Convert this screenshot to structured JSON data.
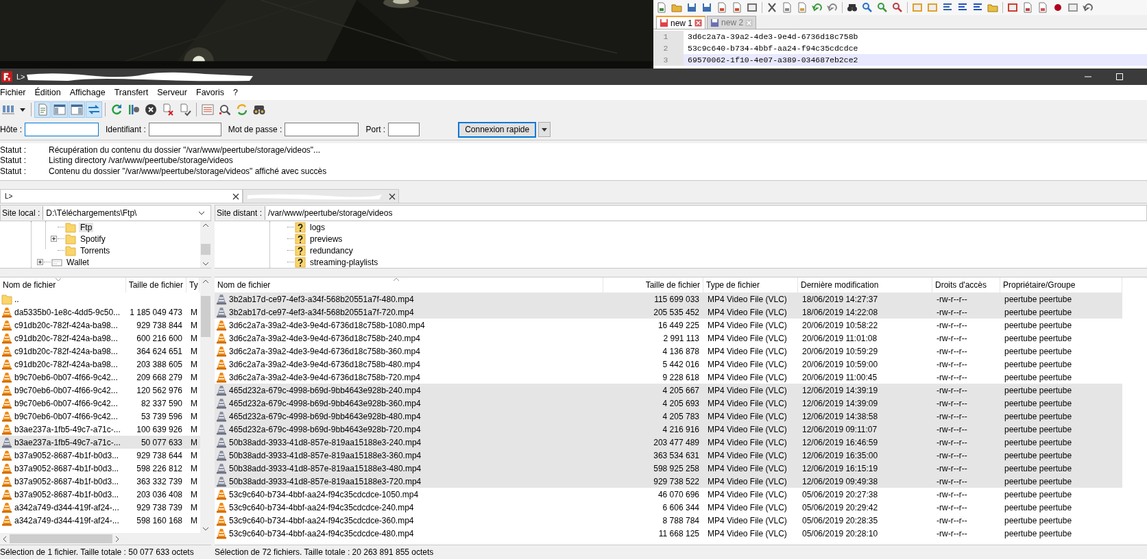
{
  "notepad": {
    "tabs": [
      {
        "label": "new 1",
        "selected": true
      },
      {
        "label": "new 2",
        "selected": false
      }
    ],
    "lines": [
      {
        "number": "1",
        "text": "3d6c2a7a-39a2-4de3-9e4d-6736d18c758b",
        "current": false
      },
      {
        "number": "2",
        "text": "53c9c640-b734-4bbf-aa24-f94c35cdcdce",
        "current": false
      },
      {
        "number": "3",
        "text": "69570062-1f10-4e07-a389-034687eb2ce2",
        "current": true
      }
    ]
  },
  "window": {
    "title": "L>"
  },
  "menu": [
    "Fichier",
    "Édition",
    "Affichage",
    "Transfert",
    "Serveur",
    "Favoris",
    "?"
  ],
  "toolbar": [
    {
      "kind": "site-manager",
      "on": false
    },
    {
      "kind": "message-log",
      "on": true
    },
    {
      "kind": "local-tree",
      "on": true
    },
    {
      "kind": "remote-tree",
      "on": true
    },
    {
      "kind": "transfer-queue",
      "on": true
    },
    {
      "kind": "refresh",
      "on": false
    },
    {
      "kind": "process-queue",
      "on": false
    },
    {
      "kind": "cancel",
      "on": false
    },
    {
      "kind": "disconnect",
      "on": false
    },
    {
      "kind": "reconnect",
      "on": false
    },
    {
      "kind": "filter",
      "on": false
    },
    {
      "kind": "compare",
      "on": false
    },
    {
      "kind": "sync",
      "on": false
    },
    {
      "kind": "find",
      "on": false
    }
  ],
  "quickconnect": {
    "fields": [
      {
        "label": "Hôte :",
        "focused": true
      },
      {
        "label": "Identifiant :",
        "focused": false
      },
      {
        "label": "Mot de passe :",
        "focused": false
      },
      {
        "label": "Port :",
        "focused": false
      }
    ],
    "button": "Connexion rapide"
  },
  "log": [
    {
      "label": "Statut :",
      "text": "Récupération du contenu du dossier \"/var/www/peertube/storage/videos\"..."
    },
    {
      "label": "Statut :",
      "text": "Listing directory /var/www/peertube/storage/videos"
    },
    {
      "label": "Statut :",
      "text": "Contenu du dossier \"/var/www/peertube/storage/videos\" affiché avec succès"
    }
  ],
  "tabs": [
    {
      "label": "L>",
      "selected": true
    },
    {
      "selected": false
    }
  ],
  "local": {
    "site_label": "Site local :",
    "path": "D:\\Téléchargements\\Ftp\\",
    "tree": [
      {
        "children": [
          {
            "label": "Ftp",
            "kind": "folder",
            "selected": true,
            "expandable": false
          },
          {
            "label": "Spotify",
            "kind": "folder",
            "selected": false,
            "expandable": true
          },
          {
            "label": "Torrents",
            "kind": "folder",
            "selected": false,
            "expandable": false
          }
        ]
      },
      {
        "label": "Wallet",
        "kind": "drive",
        "selected": false,
        "expandable": true
      }
    ],
    "columns": [
      {
        "label": "Nom de fichier"
      },
      {
        "label": "Taille de fichier"
      },
      {
        "label": "Ty"
      }
    ],
    "rows": [
      {
        "kind": "folder",
        "name": "..",
        "selected": false
      },
      {
        "kind": "video",
        "name": "da5335b0-1e8c-4dd5-9c50...",
        "size": "1 185 049 473",
        "type": "M",
        "selected": false
      },
      {
        "kind": "video",
        "name": "c91db20c-782f-424a-ba98...",
        "size": "929 738 844",
        "type": "M",
        "selected": false
      },
      {
        "kind": "video",
        "name": "c91db20c-782f-424a-ba98...",
        "size": "600 216 600",
        "type": "M",
        "selected": false
      },
      {
        "kind": "video",
        "name": "c91db20c-782f-424a-ba98...",
        "size": "364 624 651",
        "type": "M",
        "selected": false
      },
      {
        "kind": "video",
        "name": "c91db20c-782f-424a-ba98...",
        "size": "203 388 605",
        "type": "M",
        "selected": false
      },
      {
        "kind": "video",
        "name": "b9c70eb6-0b07-4f66-9c42...",
        "size": "209 668 279",
        "type": "M",
        "selected": false
      },
      {
        "kind": "video",
        "name": "b9c70eb6-0b07-4f66-9c42...",
        "size": "120 562 976",
        "type": "M",
        "selected": false
      },
      {
        "kind": "video",
        "name": "b9c70eb6-0b07-4f66-9c42...",
        "size": "82 337 590",
        "type": "M",
        "selected": false
      },
      {
        "kind": "video",
        "name": "b9c70eb6-0b07-4f66-9c42...",
        "size": "53 739 596",
        "type": "M",
        "selected": false
      },
      {
        "kind": "video",
        "name": "b3ae237a-1fb5-49c7-a71c-...",
        "size": "100 639 926",
        "type": "M",
        "selected": false
      },
      {
        "kind": "video",
        "name": "b3ae237a-1fb5-49c7-a71c-...",
        "size": "50 077 633",
        "type": "M",
        "selected": true
      },
      {
        "kind": "video",
        "name": "b37a9052-8687-4b1f-b0d3...",
        "size": "929 738 644",
        "type": "M",
        "selected": false
      },
      {
        "kind": "video",
        "name": "b37a9052-8687-4b1f-b0d3...",
        "size": "598 226 812",
        "type": "M",
        "selected": false
      },
      {
        "kind": "video",
        "name": "b37a9052-8687-4b1f-b0d3...",
        "size": "363 332 739",
        "type": "M",
        "selected": false
      },
      {
        "kind": "video",
        "name": "b37a9052-8687-4b1f-b0d3...",
        "size": "203 036 408",
        "type": "M",
        "selected": false
      },
      {
        "kind": "video",
        "name": "a342a749-d344-419f-af24-...",
        "size": "929 738 739",
        "type": "M",
        "selected": false
      },
      {
        "kind": "video",
        "name": "a342a749-d344-419f-af24-...",
        "size": "598 160 168",
        "type": "M",
        "selected": false
      }
    ],
    "status": "Sélection de 1 fichier. Taille totale : 50 077 633 octets"
  },
  "remote": {
    "site_label": "Site distant :",
    "path": "/var/www/peertube/storage/videos",
    "tree": [
      {
        "children": [
          {
            "label": "logs",
            "kind": "unknown",
            "selected": false,
            "expandable": false
          },
          {
            "label": "previews",
            "kind": "unknown",
            "selected": false,
            "expandable": false
          },
          {
            "label": "redundancy",
            "kind": "unknown",
            "selected": false,
            "expandable": false
          },
          {
            "label": "streaming-playlists",
            "kind": "unknown",
            "selected": false,
            "expandable": false
          }
        ]
      }
    ],
    "columns": [
      {
        "label": "Nom de fichier"
      },
      {
        "label": "Taille de fichier"
      },
      {
        "label": "Type de fichier"
      },
      {
        "label": "Dernière modification"
      },
      {
        "label": "Droits d'accès"
      },
      {
        "label": "Propriétaire/Groupe"
      }
    ],
    "rows": [
      {
        "kind": "video",
        "name": "3b2ab17d-ce97-4ef3-a34f-568b20551a7f-480.mp4",
        "size": "115 699 033",
        "type": "MP4 Video File (VLC)",
        "modified": "18/06/2019 14:27:37",
        "rights": "-rw-r--r--",
        "owner": "peertube peertube",
        "selected": true
      },
      {
        "kind": "video",
        "name": "3b2ab17d-ce97-4ef3-a34f-568b20551a7f-720.mp4",
        "size": "205 535 452",
        "type": "MP4 Video File (VLC)",
        "modified": "18/06/2019 14:22:08",
        "rights": "-rw-r--r--",
        "owner": "peertube peertube",
        "selected": true
      },
      {
        "kind": "video",
        "name": "3d6c2a7a-39a2-4de3-9e4d-6736d18c758b-1080.mp4",
        "size": "16 449 225",
        "type": "MP4 Video File (VLC)",
        "modified": "20/06/2019 10:58:22",
        "rights": "-rw-r--r--",
        "owner": "peertube peertube",
        "selected": false
      },
      {
        "kind": "video",
        "name": "3d6c2a7a-39a2-4de3-9e4d-6736d18c758b-240.mp4",
        "size": "2 991 113",
        "type": "MP4 Video File (VLC)",
        "modified": "20/06/2019 11:01:08",
        "rights": "-rw-r--r--",
        "owner": "peertube peertube",
        "selected": false
      },
      {
        "kind": "video",
        "name": "3d6c2a7a-39a2-4de3-9e4d-6736d18c758b-360.mp4",
        "size": "4 136 878",
        "type": "MP4 Video File (VLC)",
        "modified": "20/06/2019 10:59:29",
        "rights": "-rw-r--r--",
        "owner": "peertube peertube",
        "selected": false
      },
      {
        "kind": "video",
        "name": "3d6c2a7a-39a2-4de3-9e4d-6736d18c758b-480.mp4",
        "size": "5 442 016",
        "type": "MP4 Video File (VLC)",
        "modified": "20/06/2019 10:59:00",
        "rights": "-rw-r--r--",
        "owner": "peertube peertube",
        "selected": false
      },
      {
        "kind": "video",
        "name": "3d6c2a7a-39a2-4de3-9e4d-6736d18c758b-720.mp4",
        "size": "9 228 618",
        "type": "MP4 Video File (VLC)",
        "modified": "20/06/2019 11:00:45",
        "rights": "-rw-r--r--",
        "owner": "peertube peertube",
        "selected": false
      },
      {
        "kind": "video",
        "name": "465d232a-679c-4998-b69d-9bb4643e928b-240.mp4",
        "size": "4 205 667",
        "type": "MP4 Video File (VLC)",
        "modified": "12/06/2019 14:39:19",
        "rights": "-rw-r--r--",
        "owner": "peertube peertube",
        "selected": true
      },
      {
        "kind": "video",
        "name": "465d232a-679c-4998-b69d-9bb4643e928b-360.mp4",
        "size": "4 205 693",
        "type": "MP4 Video File (VLC)",
        "modified": "12/06/2019 14:39:09",
        "rights": "-rw-r--r--",
        "owner": "peertube peertube",
        "selected": true
      },
      {
        "kind": "video",
        "name": "465d232a-679c-4998-b69d-9bb4643e928b-480.mp4",
        "size": "4 205 783",
        "type": "MP4 Video File (VLC)",
        "modified": "12/06/2019 14:38:58",
        "rights": "-rw-r--r--",
        "owner": "peertube peertube",
        "selected": true
      },
      {
        "kind": "video",
        "name": "465d232a-679c-4998-b69d-9bb4643e928b-720.mp4",
        "size": "4 216 916",
        "type": "MP4 Video File (VLC)",
        "modified": "12/06/2019 09:11:07",
        "rights": "-rw-r--r--",
        "owner": "peertube peertube",
        "selected": true
      },
      {
        "kind": "video",
        "name": "50b38add-3933-41d8-857e-819aa15188e3-240.mp4",
        "size": "203 477 489",
        "type": "MP4 Video File (VLC)",
        "modified": "12/06/2019 16:46:59",
        "rights": "-rw-r--r--",
        "owner": "peertube peertube",
        "selected": true
      },
      {
        "kind": "video",
        "name": "50b38add-3933-41d8-857e-819aa15188e3-360.mp4",
        "size": "363 534 631",
        "type": "MP4 Video File (VLC)",
        "modified": "12/06/2019 16:35:00",
        "rights": "-rw-r--r--",
        "owner": "peertube peertube",
        "selected": true
      },
      {
        "kind": "video",
        "name": "50b38add-3933-41d8-857e-819aa15188e3-480.mp4",
        "size": "598 925 258",
        "type": "MP4 Video File (VLC)",
        "modified": "12/06/2019 16:15:19",
        "rights": "-rw-r--r--",
        "owner": "peertube peertube",
        "selected": true
      },
      {
        "kind": "video",
        "name": "50b38add-3933-41d8-857e-819aa15188e3-720.mp4",
        "size": "929 738 522",
        "type": "MP4 Video File (VLC)",
        "modified": "12/06/2019 09:49:38",
        "rights": "-rw-r--r--",
        "owner": "peertube peertube",
        "selected": true
      },
      {
        "kind": "video",
        "name": "53c9c640-b734-4bbf-aa24-f94c35cdcdce-1050.mp4",
        "size": "46 070 696",
        "type": "MP4 Video File (VLC)",
        "modified": "05/06/2019 20:27:38",
        "rights": "-rw-r--r--",
        "owner": "peertube peertube",
        "selected": false
      },
      {
        "kind": "video",
        "name": "53c9c640-b734-4bbf-aa24-f94c35cdcdce-240.mp4",
        "size": "6 606 344",
        "type": "MP4 Video File (VLC)",
        "modified": "05/06/2019 20:29:42",
        "rights": "-rw-r--r--",
        "owner": "peertube peertube",
        "selected": false
      },
      {
        "kind": "video",
        "name": "53c9c640-b734-4bbf-aa24-f94c35cdcdce-360.mp4",
        "size": "8 788 784",
        "type": "MP4 Video File (VLC)",
        "modified": "05/06/2019 20:28:35",
        "rights": "-rw-r--r--",
        "owner": "peertube peertube",
        "selected": false
      },
      {
        "kind": "video",
        "name": "53c9c640-b734-4bbf-aa24-f94c35cdcdce-480.mp4",
        "size": "11 668 125",
        "type": "MP4 Video File (VLC)",
        "modified": "05/06/2019 20:28:10",
        "rights": "-rw-r--r--",
        "owner": "peertube peertube",
        "selected": false
      }
    ],
    "status": "Sélection de 72 fichiers. Taille totale : 20 263 891 855 octets"
  }
}
